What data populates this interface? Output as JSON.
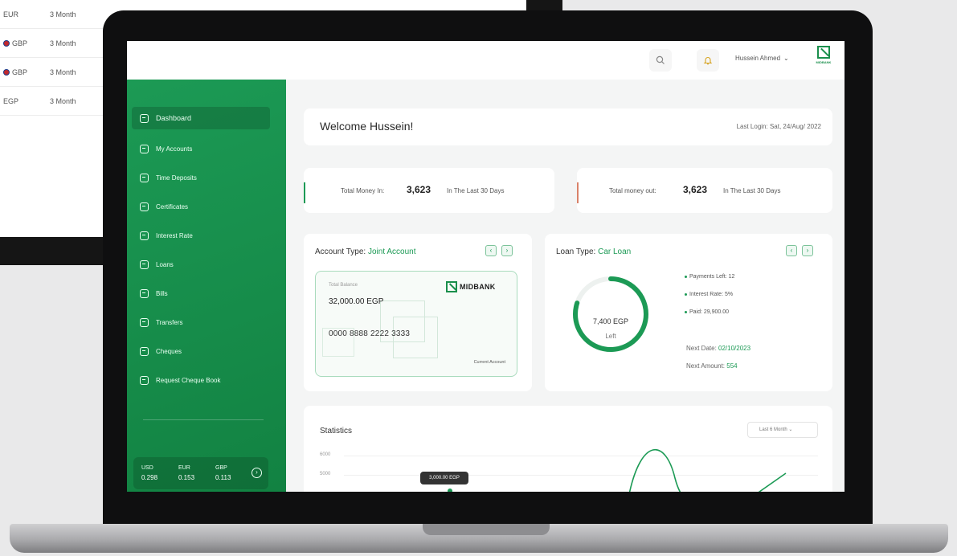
{
  "background_table": {
    "rows": [
      {
        "currency": "EUR",
        "term": "3 Month",
        "flag": false
      },
      {
        "currency": "GBP",
        "term": "3 Month",
        "flag": true
      },
      {
        "currency": "GBP",
        "term": "3 Month",
        "flag": true
      },
      {
        "currency": "EGP",
        "term": "3 Month",
        "flag": false
      }
    ]
  },
  "topbar": {
    "user_name": "Hussein Ahmed",
    "logo_text": "MIDBANK"
  },
  "sidebar": {
    "items": [
      {
        "label": "Dashboard",
        "icon": "dashboard-icon",
        "active": true
      },
      {
        "label": "My Accounts",
        "icon": "accounts-icon",
        "active": false
      },
      {
        "label": "Time Deposits",
        "icon": "deposits-icon",
        "active": false
      },
      {
        "label": "Certificates",
        "icon": "certificates-icon",
        "active": false
      },
      {
        "label": "Interest Rate",
        "icon": "interest-rate-icon",
        "active": false
      },
      {
        "label": "Loans",
        "icon": "loans-icon",
        "active": false
      },
      {
        "label": "Bills",
        "icon": "bills-icon",
        "active": false
      },
      {
        "label": "Transfers",
        "icon": "transfers-icon",
        "active": false
      },
      {
        "label": "Cheques",
        "icon": "cheques-icon",
        "active": false
      },
      {
        "label": "Request Cheque Book",
        "icon": "cheque-book-icon",
        "active": false
      }
    ],
    "rates": [
      {
        "currency": "USD",
        "value": "0.298"
      },
      {
        "currency": "EUR",
        "value": "0.153"
      },
      {
        "currency": "GBP",
        "value": "0.113"
      }
    ]
  },
  "welcome": {
    "title": "Welcome Hussein!",
    "last_login": "Last Login: Sat, 24/Aug/ 2022"
  },
  "money_in": {
    "label": "Total Money In:",
    "value": "3,623",
    "period": "In The Last 30 Days"
  },
  "money_out": {
    "label": "Total money out:",
    "value": "3,623",
    "period": "In The Last 30 Days"
  },
  "account": {
    "title_prefix": "Account Type:",
    "type": "Joint Account",
    "card": {
      "balance_label": "Total Balance",
      "balance": "32,000.00 EGP",
      "number": "0000 8888 2222 3333",
      "account_kind": "Current Account",
      "bank_name": "MIDBANK"
    }
  },
  "loan": {
    "title_prefix": "Loan Type:",
    "type": "Car Loan",
    "remaining": "7,400 EGP",
    "remaining_label": "Left",
    "paid_fraction": 0.8,
    "payments_left": "Payments Left: 12",
    "interest": "Interest Rate: 5%",
    "paid": "Paid: 29,900.00",
    "next_date_label": "Next Date:",
    "next_date": "02/10/2023",
    "next_amount_label": "Next Amount:",
    "next_amount": "554"
  },
  "statistics": {
    "title": "Statistics",
    "range": "Last 6 Month",
    "y_ticks": [
      "6000",
      "5000"
    ],
    "tooltip": "3,000.00 EGP"
  },
  "colors": {
    "brand_green": "#1c9a55",
    "money_in_bar": "#1c9a55",
    "money_out_bar": "#d9826a"
  }
}
